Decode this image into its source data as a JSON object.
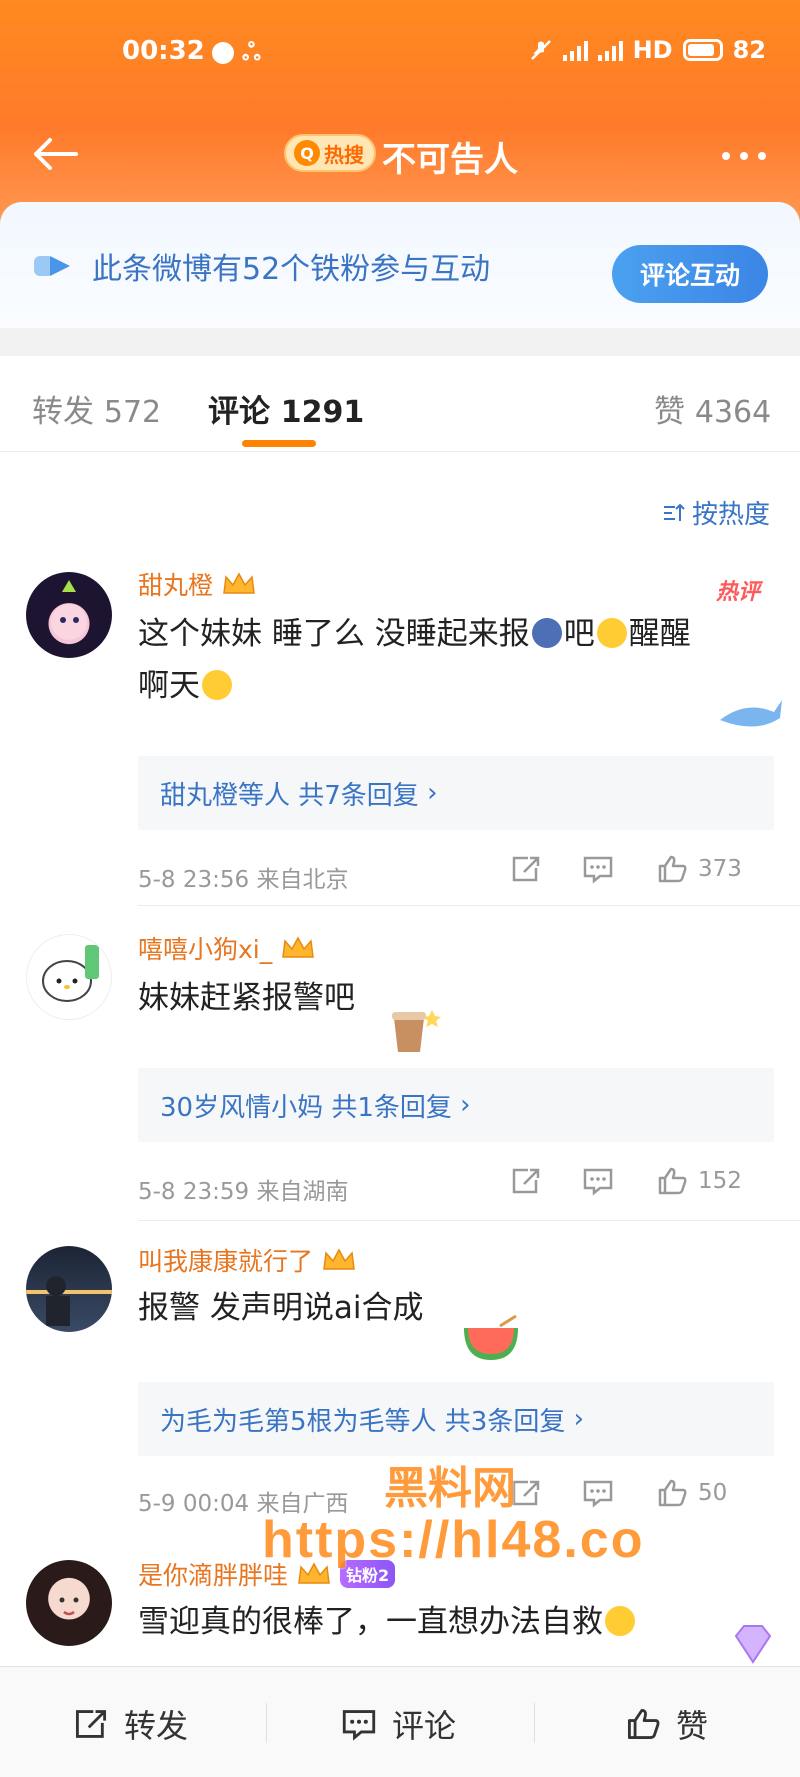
{
  "status_bar": {
    "time": "00:32",
    "network": "HD",
    "battery": "82"
  },
  "nav": {
    "hot_badge": "热搜",
    "title": "不可告人"
  },
  "fans_card": {
    "text": "此条微博有52个铁粉参与互动",
    "button": "评论互动"
  },
  "tabs": [
    {
      "label": "转发",
      "count": "572"
    },
    {
      "label": "评论",
      "count": "1291"
    },
    {
      "label": "赞",
      "count": "4364"
    }
  ],
  "sort": {
    "label": "按热度"
  },
  "comments": [
    {
      "username": "甜丸橙",
      "hot_tag": "热评",
      "line1": "这个妹妹 睡了么 没睡起来报",
      "line1b": "吧",
      "line1c": "醒醒",
      "line2": "啊天",
      "replies": "甜丸橙等人 共7条回复",
      "time": "5-8 23:56",
      "location": "来自北京",
      "likes": "373"
    },
    {
      "username": "嘻嘻小狗xi_",
      "line1": "妹妹赶紧报警吧",
      "replies": "30岁风情小妈 共1条回复",
      "time": "5-8 23:59",
      "location": "来自湖南",
      "likes": "152"
    },
    {
      "username": "叫我康康就行了",
      "line1": "报警 发声明说ai合成",
      "replies": "为毛为毛第5根为毛等人 共3条回复",
      "time": "5-9 00:04",
      "location": "来自广西",
      "likes": "50"
    },
    {
      "username": "是你滴胖胖哇",
      "fan_badge": "钻粉2",
      "line1": "雪迎真的很棒了，一直想办法自救"
    }
  ],
  "bottom_bar": {
    "repost": "转发",
    "comment": "评论",
    "like": "赞"
  },
  "watermark": {
    "line1": "黑料网",
    "line2": "https://hl48.co"
  },
  "colors": {
    "brand_orange": "#ff8200",
    "link_blue": "#3a74c4",
    "username_orange": "#e8751f"
  }
}
